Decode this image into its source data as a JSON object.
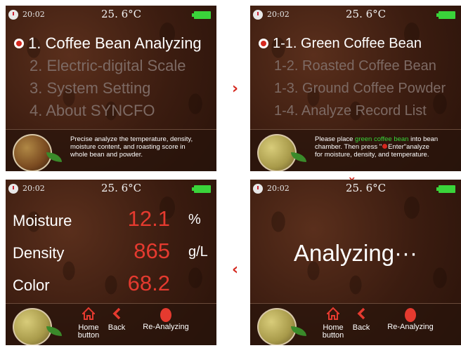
{
  "status": {
    "time": "20:02",
    "temperature": "25. 6°C"
  },
  "screen1": {
    "menu": [
      "1. Coffee Bean Analyzing",
      "2. Electric-digital Scale",
      "3. System Setting",
      "4. About SYNCFO"
    ],
    "info": [
      "Precise analyze the temperature, density,",
      "moisture content, and roasting score in",
      "whole bean and powder."
    ]
  },
  "screen2": {
    "menu": [
      "1-1. Green Coffee Bean",
      "1-2. Roasted Coffee Bean",
      "1-3. Ground Coffee Powder",
      "1-4. Analyze Record List"
    ],
    "info_line1_a": "Please place ",
    "info_line1_b": "green coffee bean",
    "info_line1_c": " into bean",
    "info_line2_a": "chamber. Then press \"",
    "info_line2_b": "Enter\"analyze",
    "info_line3": "for moisture, density, and temperature."
  },
  "screen3": {
    "measurements": [
      {
        "label": "Moisture",
        "value": "12.1",
        "unit": "%"
      },
      {
        "label": "Density",
        "value": "865",
        "unit": "g/L"
      },
      {
        "label": "Color",
        "value": "68.2",
        "unit": ""
      }
    ]
  },
  "screen4": {
    "message": "Analyzing···"
  },
  "buttons": {
    "home_line1": "Home",
    "home_line2": "button",
    "back": "Back",
    "reanalyze": "Re-Analyzing"
  },
  "arrows": {
    "right": "›",
    "down": "›",
    "left": "‹"
  },
  "colors": {
    "accent": "#e53a2f",
    "battery": "#3ad43a",
    "menu_selected": "#ffffff",
    "menu_dim": "#7d6a64"
  }
}
